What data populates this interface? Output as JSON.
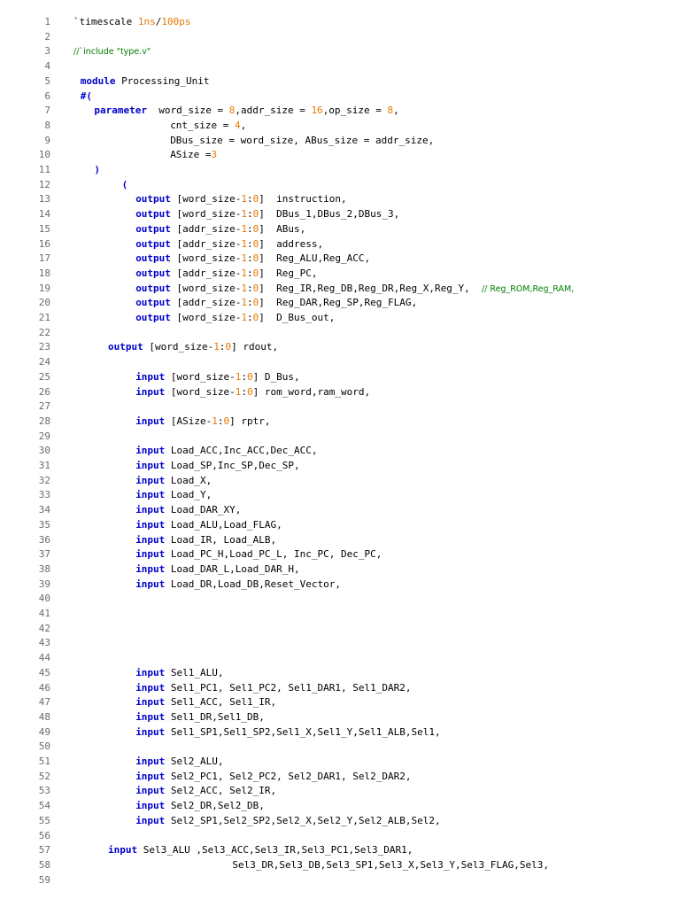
{
  "colors": {
    "keyword": "#0000cc",
    "number": "#e87800",
    "comment": "#008000",
    "line_number": "#6b6b6b",
    "text": "#000000"
  },
  "lines": [
    {
      "n": "1",
      "indent": 0,
      "tokens": [
        {
          "t": "pl",
          "v": "`timescale "
        },
        {
          "t": "num",
          "v": "1ns"
        },
        {
          "t": "pl",
          "v": "/"
        },
        {
          "t": "num",
          "v": "100ps"
        }
      ]
    },
    {
      "n": "2",
      "indent": 0,
      "tokens": []
    },
    {
      "n": "3",
      "indent": 0,
      "tokens": [
        {
          "t": "cmt",
          "v": "//`include \"type.v\""
        }
      ]
    },
    {
      "n": "4",
      "indent": 0,
      "tokens": []
    },
    {
      "n": "5",
      "indent": 1,
      "tokens": [
        {
          "t": "kw",
          "v": "module"
        },
        {
          "t": "pl",
          "v": " Processing_Unit"
        }
      ]
    },
    {
      "n": "6",
      "indent": 1,
      "tokens": [
        {
          "t": "kw",
          "v": "#("
        }
      ]
    },
    {
      "n": "7",
      "indent": 3,
      "tokens": [
        {
          "t": "kw",
          "v": "parameter"
        },
        {
          "t": "pl",
          "v": "  word_size = "
        },
        {
          "t": "num",
          "v": "8"
        },
        {
          "t": "pl",
          "v": ",addr_size = "
        },
        {
          "t": "num",
          "v": "16"
        },
        {
          "t": "pl",
          "v": ",op_size = "
        },
        {
          "t": "num",
          "v": "8"
        },
        {
          "t": "pl",
          "v": ","
        }
      ]
    },
    {
      "n": "8",
      "indent": 14,
      "tokens": [
        {
          "t": "pl",
          "v": "cnt_size = "
        },
        {
          "t": "num",
          "v": "4"
        },
        {
          "t": "pl",
          "v": ","
        }
      ]
    },
    {
      "n": "9",
      "indent": 14,
      "tokens": [
        {
          "t": "pl",
          "v": "DBus_size = word_size, ABus_size = addr_size,"
        }
      ]
    },
    {
      "n": "10",
      "indent": 14,
      "tokens": [
        {
          "t": "pl",
          "v": "ASize ="
        },
        {
          "t": "num",
          "v": "3"
        }
      ]
    },
    {
      "n": "11",
      "indent": 3,
      "tokens": [
        {
          "t": "kw",
          "v": ")"
        }
      ]
    },
    {
      "n": "12",
      "indent": 7,
      "tokens": [
        {
          "t": "kw",
          "v": "("
        }
      ]
    },
    {
      "n": "13",
      "indent": 9,
      "tokens": [
        {
          "t": "kw",
          "v": "output"
        },
        {
          "t": "pl",
          "v": " [word_size-"
        },
        {
          "t": "num",
          "v": "1"
        },
        {
          "t": "pl",
          "v": ":"
        },
        {
          "t": "num",
          "v": "0"
        },
        {
          "t": "pl",
          "v": "]  instruction,"
        }
      ]
    },
    {
      "n": "14",
      "indent": 9,
      "tokens": [
        {
          "t": "kw",
          "v": "output"
        },
        {
          "t": "pl",
          "v": " [word_size-"
        },
        {
          "t": "num",
          "v": "1"
        },
        {
          "t": "pl",
          "v": ":"
        },
        {
          "t": "num",
          "v": "0"
        },
        {
          "t": "pl",
          "v": "]  DBus_1,DBus_2,DBus_3,"
        }
      ]
    },
    {
      "n": "15",
      "indent": 9,
      "tokens": [
        {
          "t": "kw",
          "v": "output"
        },
        {
          "t": "pl",
          "v": " [addr_size-"
        },
        {
          "t": "num",
          "v": "1"
        },
        {
          "t": "pl",
          "v": ":"
        },
        {
          "t": "num",
          "v": "0"
        },
        {
          "t": "pl",
          "v": "]  ABus,"
        }
      ]
    },
    {
      "n": "16",
      "indent": 9,
      "tokens": [
        {
          "t": "kw",
          "v": "output"
        },
        {
          "t": "pl",
          "v": " [addr_size-"
        },
        {
          "t": "num",
          "v": "1"
        },
        {
          "t": "pl",
          "v": ":"
        },
        {
          "t": "num",
          "v": "0"
        },
        {
          "t": "pl",
          "v": "]  address,"
        }
      ]
    },
    {
      "n": "17",
      "indent": 9,
      "tokens": [
        {
          "t": "kw",
          "v": "output"
        },
        {
          "t": "pl",
          "v": " [word_size-"
        },
        {
          "t": "num",
          "v": "1"
        },
        {
          "t": "pl",
          "v": ":"
        },
        {
          "t": "num",
          "v": "0"
        },
        {
          "t": "pl",
          "v": "]  Reg_ALU,Reg_ACC,"
        }
      ]
    },
    {
      "n": "18",
      "indent": 9,
      "tokens": [
        {
          "t": "kw",
          "v": "output"
        },
        {
          "t": "pl",
          "v": " [addr_size-"
        },
        {
          "t": "num",
          "v": "1"
        },
        {
          "t": "pl",
          "v": ":"
        },
        {
          "t": "num",
          "v": "0"
        },
        {
          "t": "pl",
          "v": "]  Reg_PC,"
        }
      ]
    },
    {
      "n": "19",
      "indent": 9,
      "tokens": [
        {
          "t": "kw",
          "v": "output"
        },
        {
          "t": "pl",
          "v": " [word_size-"
        },
        {
          "t": "num",
          "v": "1"
        },
        {
          "t": "pl",
          "v": ":"
        },
        {
          "t": "num",
          "v": "0"
        },
        {
          "t": "pl",
          "v": "]  Reg_IR,Reg_DB,Reg_DR,Reg_X,Reg_Y,  "
        },
        {
          "t": "cmt",
          "v": "// Reg_ROM,Reg_RAM,"
        }
      ]
    },
    {
      "n": "20",
      "indent": 9,
      "tokens": [
        {
          "t": "kw",
          "v": "output"
        },
        {
          "t": "pl",
          "v": " [addr_size-"
        },
        {
          "t": "num",
          "v": "1"
        },
        {
          "t": "pl",
          "v": ":"
        },
        {
          "t": "num",
          "v": "0"
        },
        {
          "t": "pl",
          "v": "]  Reg_DAR,Reg_SP,Reg_FLAG,"
        }
      ]
    },
    {
      "n": "21",
      "indent": 9,
      "tokens": [
        {
          "t": "kw",
          "v": "output"
        },
        {
          "t": "pl",
          "v": " [word_size-"
        },
        {
          "t": "num",
          "v": "1"
        },
        {
          "t": "pl",
          "v": ":"
        },
        {
          "t": "num",
          "v": "0"
        },
        {
          "t": "pl",
          "v": "]  D_Bus_out,"
        }
      ]
    },
    {
      "n": "22",
      "indent": 0,
      "tokens": []
    },
    {
      "n": "23",
      "indent": 5,
      "tokens": [
        {
          "t": "kw",
          "v": "output"
        },
        {
          "t": "pl",
          "v": " [word_size-"
        },
        {
          "t": "num",
          "v": "1"
        },
        {
          "t": "pl",
          "v": ":"
        },
        {
          "t": "num",
          "v": "0"
        },
        {
          "t": "pl",
          "v": "] rdout,"
        }
      ]
    },
    {
      "n": "24",
      "indent": 0,
      "tokens": []
    },
    {
      "n": "25",
      "indent": 9,
      "tokens": [
        {
          "t": "kw",
          "v": "input"
        },
        {
          "t": "pl",
          "v": " [word_size-"
        },
        {
          "t": "num",
          "v": "1"
        },
        {
          "t": "pl",
          "v": ":"
        },
        {
          "t": "num",
          "v": "0"
        },
        {
          "t": "pl",
          "v": "] D_Bus,"
        }
      ]
    },
    {
      "n": "26",
      "indent": 9,
      "tokens": [
        {
          "t": "kw",
          "v": "input"
        },
        {
          "t": "pl",
          "v": " [word_size-"
        },
        {
          "t": "num",
          "v": "1"
        },
        {
          "t": "pl",
          "v": ":"
        },
        {
          "t": "num",
          "v": "0"
        },
        {
          "t": "pl",
          "v": "] rom_word,ram_word,"
        }
      ]
    },
    {
      "n": "27",
      "indent": 0,
      "tokens": []
    },
    {
      "n": "28",
      "indent": 9,
      "tokens": [
        {
          "t": "kw",
          "v": "input"
        },
        {
          "t": "pl",
          "v": " [ASize-"
        },
        {
          "t": "num",
          "v": "1"
        },
        {
          "t": "pl",
          "v": ":"
        },
        {
          "t": "num",
          "v": "0"
        },
        {
          "t": "pl",
          "v": "] rptr,"
        }
      ]
    },
    {
      "n": "29",
      "indent": 0,
      "tokens": []
    },
    {
      "n": "30",
      "indent": 9,
      "tokens": [
        {
          "t": "kw",
          "v": "input"
        },
        {
          "t": "pl",
          "v": " Load_ACC,Inc_ACC,Dec_ACC,"
        }
      ]
    },
    {
      "n": "31",
      "indent": 9,
      "tokens": [
        {
          "t": "kw",
          "v": "input"
        },
        {
          "t": "pl",
          "v": " Load_SP,Inc_SP,Dec_SP,"
        }
      ]
    },
    {
      "n": "32",
      "indent": 9,
      "tokens": [
        {
          "t": "kw",
          "v": "input"
        },
        {
          "t": "pl",
          "v": " Load_X,"
        }
      ]
    },
    {
      "n": "33",
      "indent": 9,
      "tokens": [
        {
          "t": "kw",
          "v": "input"
        },
        {
          "t": "pl",
          "v": " Load_Y,"
        }
      ]
    },
    {
      "n": "34",
      "indent": 9,
      "tokens": [
        {
          "t": "kw",
          "v": "input"
        },
        {
          "t": "pl",
          "v": " Load_DAR_XY,"
        }
      ]
    },
    {
      "n": "35",
      "indent": 9,
      "tokens": [
        {
          "t": "kw",
          "v": "input"
        },
        {
          "t": "pl",
          "v": " Load_ALU,Load_FLAG,"
        }
      ]
    },
    {
      "n": "36",
      "indent": 9,
      "tokens": [
        {
          "t": "kw",
          "v": "input"
        },
        {
          "t": "pl",
          "v": " Load_IR, Load_ALB,"
        }
      ]
    },
    {
      "n": "37",
      "indent": 9,
      "tokens": [
        {
          "t": "kw",
          "v": "input"
        },
        {
          "t": "pl",
          "v": " Load_PC_H,Load_PC_L, Inc_PC, Dec_PC,"
        }
      ]
    },
    {
      "n": "38",
      "indent": 9,
      "tokens": [
        {
          "t": "kw",
          "v": "input"
        },
        {
          "t": "pl",
          "v": " Load_DAR_L,Load_DAR_H,"
        }
      ]
    },
    {
      "n": "39",
      "indent": 9,
      "tokens": [
        {
          "t": "kw",
          "v": "input"
        },
        {
          "t": "pl",
          "v": " Load_DR,Load_DB,Reset_Vector,"
        }
      ]
    },
    {
      "n": "40",
      "indent": 0,
      "tokens": []
    },
    {
      "n": "41",
      "indent": 0,
      "tokens": []
    },
    {
      "n": "42",
      "indent": 0,
      "tokens": []
    },
    {
      "n": "43",
      "indent": 0,
      "tokens": []
    },
    {
      "n": "44",
      "indent": 0,
      "tokens": []
    },
    {
      "n": "45",
      "indent": 9,
      "tokens": [
        {
          "t": "kw",
          "v": "input"
        },
        {
          "t": "pl",
          "v": " Sel1_ALU,"
        }
      ]
    },
    {
      "n": "46",
      "indent": 9,
      "tokens": [
        {
          "t": "kw",
          "v": "input"
        },
        {
          "t": "pl",
          "v": " Sel1_PC1, Sel1_PC2, Sel1_DAR1, Sel1_DAR2,"
        }
      ]
    },
    {
      "n": "47",
      "indent": 9,
      "tokens": [
        {
          "t": "kw",
          "v": "input"
        },
        {
          "t": "pl",
          "v": " Sel1_ACC, Sel1_IR,"
        }
      ]
    },
    {
      "n": "48",
      "indent": 9,
      "tokens": [
        {
          "t": "kw",
          "v": "input"
        },
        {
          "t": "pl",
          "v": " Sel1_DR,Sel1_DB,"
        }
      ]
    },
    {
      "n": "49",
      "indent": 9,
      "tokens": [
        {
          "t": "kw",
          "v": "input"
        },
        {
          "t": "pl",
          "v": " Sel1_SP1,Sel1_SP2,Sel1_X,Sel1_Y,Sel1_ALB,Sel1,"
        }
      ]
    },
    {
      "n": "50",
      "indent": 0,
      "tokens": []
    },
    {
      "n": "51",
      "indent": 9,
      "tokens": [
        {
          "t": "kw",
          "v": "input"
        },
        {
          "t": "pl",
          "v": " Sel2_ALU,"
        }
      ]
    },
    {
      "n": "52",
      "indent": 9,
      "tokens": [
        {
          "t": "kw",
          "v": "input"
        },
        {
          "t": "pl",
          "v": " Sel2_PC1, Sel2_PC2, Sel2_DAR1, Sel2_DAR2,"
        }
      ]
    },
    {
      "n": "53",
      "indent": 9,
      "tokens": [
        {
          "t": "kw",
          "v": "input"
        },
        {
          "t": "pl",
          "v": " Sel2_ACC, Sel2_IR,"
        }
      ]
    },
    {
      "n": "54",
      "indent": 9,
      "tokens": [
        {
          "t": "kw",
          "v": "input"
        },
        {
          "t": "pl",
          "v": " Sel2_DR,Sel2_DB,"
        }
      ]
    },
    {
      "n": "55",
      "indent": 9,
      "tokens": [
        {
          "t": "kw",
          "v": "input"
        },
        {
          "t": "pl",
          "v": " Sel2_SP1,Sel2_SP2,Sel2_X,Sel2_Y,Sel2_ALB,Sel2,"
        }
      ]
    },
    {
      "n": "56",
      "indent": 0,
      "tokens": []
    },
    {
      "n": "57",
      "indent": 5,
      "tokens": [
        {
          "t": "kw",
          "v": "input"
        },
        {
          "t": "pl",
          "v": " Sel3_ALU ,Sel3_ACC,Sel3_IR,Sel3_PC1,Sel3_DAR1,"
        }
      ]
    },
    {
      "n": "58",
      "indent": 23,
      "tokens": [
        {
          "t": "pl",
          "v": "Sel3_DR,Sel3_DB,Sel3_SP1,Sel3_X,Sel3_Y,Sel3_FLAG,Sel3,"
        }
      ]
    },
    {
      "n": "59",
      "indent": 0,
      "tokens": []
    }
  ]
}
